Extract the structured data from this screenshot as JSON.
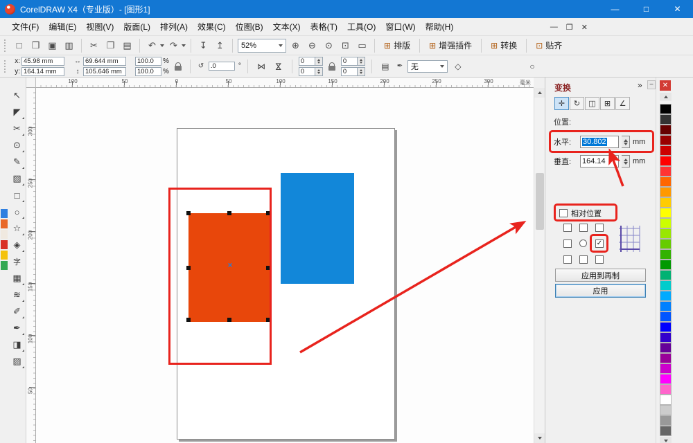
{
  "colors": {
    "titlebar_bg": "#1377d3",
    "annotation": "#e8231d",
    "selection": "#0078d7",
    "orange_rect": "#e8470b",
    "blue_rect": "#1287d9",
    "docker_title": "#8b2525",
    "close_red": "#d23b34",
    "center_marker": "#2b7bd3"
  },
  "titlebar": {
    "title": "CorelDRAW X4（专业版）- [图形1]",
    "minimize": "—",
    "maximize": "□",
    "close": "✕"
  },
  "menubar": {
    "items": [
      "文件(F)",
      "编辑(E)",
      "视图(V)",
      "版面(L)",
      "排列(A)",
      "效果(C)",
      "位图(B)",
      "文本(X)",
      "表格(T)",
      "工具(O)",
      "窗口(W)",
      "帮助(H)"
    ],
    "doc_minimize": "—",
    "doc_restore": "❐",
    "doc_close": "✕"
  },
  "toolbar": {
    "icons": [
      {
        "name": "new-document-button",
        "glyph": "□"
      },
      {
        "name": "open-button",
        "glyph": "❒"
      },
      {
        "name": "save-button",
        "glyph": "▣"
      },
      {
        "name": "print-button",
        "glyph": "▥"
      },
      {
        "name": "cut-button",
        "glyph": "✂"
      },
      {
        "name": "copy-button",
        "glyph": "❐"
      },
      {
        "name": "paste-button",
        "glyph": "▤"
      },
      {
        "name": "undo-button",
        "glyph": "↶"
      },
      {
        "name": "redo-button",
        "glyph": "↷"
      },
      {
        "name": "import-button",
        "glyph": "↧"
      },
      {
        "name": "export-button",
        "glyph": "↥"
      }
    ],
    "zoom_value": "52%",
    "zoom_icons": [
      {
        "name": "zoom-in-button",
        "glyph": "⊕"
      },
      {
        "name": "zoom-out-button",
        "glyph": "⊖"
      },
      {
        "name": "zoom-selected-button",
        "glyph": "⊙"
      },
      {
        "name": "zoom-page-button",
        "glyph": "⊡"
      },
      {
        "name": "zoom-width-button",
        "glyph": "▭"
      }
    ],
    "plugins": [
      {
        "glyph": "⊞",
        "label": "排版"
      },
      {
        "glyph": "⊞",
        "label": "增强插件"
      },
      {
        "glyph": "⊞",
        "label": "转换"
      },
      {
        "glyph": "⊡",
        "label": "贴齐"
      }
    ]
  },
  "propbar": {
    "x_label": "x:",
    "x_value": "45.98 mm",
    "y_label": "y:",
    "y_value": "164.14 mm",
    "width_icon": "↔",
    "width_value": "69.644 mm",
    "height_icon": "↕",
    "height_value": "105.646 mm",
    "scale_h": "100.0",
    "scale_v": "100.0",
    "percent": "%",
    "angle_icon": "↺",
    "angle_value": ".0",
    "degree": "°",
    "mirror_h_glyph": "⋈",
    "mirror_v_glyph": "⋈",
    "corner_tl": "0",
    "corner_tr": "0",
    "corner_bl": "0",
    "corner_br": "0",
    "wrap_glyph": "▤",
    "outline_pen_glyph": "✒",
    "outline_value": "无",
    "curves_glyph": "◇",
    "options_glyph": "○"
  },
  "rulers": {
    "h": [
      "100",
      "50",
      "0",
      "50",
      "100",
      "150",
      "200",
      "250",
      "300"
    ],
    "v": [
      "300",
      "250",
      "200",
      "150",
      "100",
      "50"
    ],
    "unit": "毫米"
  },
  "toolbox": {
    "tools": [
      {
        "name": "pick-tool",
        "glyph": "↖"
      },
      {
        "name": "shape-tool",
        "glyph": "◤"
      },
      {
        "name": "crop-tool",
        "glyph": "✂"
      },
      {
        "name": "zoom-tool",
        "glyph": "⊙"
      },
      {
        "name": "freehand-tool",
        "glyph": "✎"
      },
      {
        "name": "smart-fill-tool",
        "glyph": "▧"
      },
      {
        "name": "rectangle-tool",
        "glyph": "□"
      },
      {
        "name": "ellipse-tool",
        "glyph": "○"
      },
      {
        "name": "polygon-tool",
        "glyph": "☆"
      },
      {
        "name": "basic-shapes-tool",
        "glyph": "◈"
      },
      {
        "name": "text-tool",
        "glyph": "字"
      },
      {
        "name": "table-tool",
        "glyph": "▦"
      },
      {
        "name": "blend-tool",
        "glyph": "≋"
      },
      {
        "name": "eyedropper-tool",
        "glyph": "✐"
      },
      {
        "name": "outline-pen-tool",
        "glyph": "✒"
      },
      {
        "name": "fill-tool",
        "glyph": "◨"
      },
      {
        "name": "interactive-fill-tool",
        "glyph": "▨"
      }
    ]
  },
  "canvas": {
    "center_marker": "×"
  },
  "docker": {
    "title": "变换",
    "chevron": "»",
    "collapse": "−",
    "close": "✕",
    "modes": [
      {
        "name": "position-mode-button",
        "glyph": "✛"
      },
      {
        "name": "rotate-mode-button",
        "glyph": "↻"
      },
      {
        "name": "scale-mirror-mode-button",
        "glyph": "◫"
      },
      {
        "name": "size-mode-button",
        "glyph": "⊞"
      },
      {
        "name": "skew-mode-button",
        "glyph": "∠"
      }
    ],
    "position_label": "位置:",
    "horizontal_label": "水平:",
    "horizontal_value": "30.802",
    "vertical_label": "垂直:",
    "vertical_value": "164.14",
    "unit": "mm",
    "relative_label": "相对位置",
    "grid": {
      "check_glyph": "✓",
      "states": [
        [
          "unchecked",
          "unchecked",
          "unchecked"
        ],
        [
          "unchecked",
          "center",
          "checked"
        ],
        [
          "unchecked",
          "unchecked",
          "unchecked"
        ]
      ]
    },
    "apply_duplicate_label": "应用到再制",
    "apply_label": "应用"
  },
  "palette": {
    "colors": [
      "#000000",
      "#333333",
      "#660000",
      "#990000",
      "#cc0000",
      "#ff0000",
      "#ff3333",
      "#ff6600",
      "#ff9900",
      "#ffcc00",
      "#ffff00",
      "#ccff00",
      "#99e600",
      "#66cc00",
      "#33b200",
      "#009900",
      "#00b273",
      "#00cccc",
      "#00aaff",
      "#0080ff",
      "#0055ff",
      "#0000ff",
      "#3300cc",
      "#660099",
      "#990099",
      "#cc00cc",
      "#ff00ff",
      "#ff66cc",
      "#ffffff",
      "#cccccc",
      "#999999",
      "#666666"
    ]
  },
  "sliver": {
    "colors": [
      "#2f7fe0",
      "#e8682a",
      "#f0e9e0",
      "#d93025",
      "#f4c20d",
      "#34a853"
    ]
  }
}
